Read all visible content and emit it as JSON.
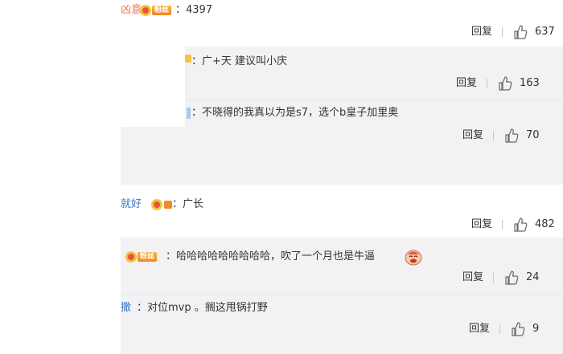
{
  "comments": [
    {
      "name_fragment": "凶意",
      "badge": "粉丝",
      "text": "：4397",
      "reply_label": "回复",
      "likes": "637"
    },
    {
      "name_fragment": "",
      "text": "：广+天 建议叫小庆",
      "reply_label": "回复",
      "likes": "163"
    },
    {
      "name_fragment": "",
      "text": "：不晓得的我真以为是s7，选个b皇子加里奥",
      "reply_label": "回复",
      "likes": "70"
    },
    {
      "name_fragment": "就好",
      "text": "：广长",
      "reply_label": "回复",
      "likes": "482"
    },
    {
      "badge": "粉丝",
      "text": "：哈哈哈哈哈哈哈哈哈，吹了一个月也是牛逼",
      "reply_label": "回复",
      "likes": "24"
    },
    {
      "name_fragment": "撒",
      "text": "：对位mvp 。搁这甩锅打野",
      "reply_label": "回复",
      "likes": "9"
    }
  ],
  "colors": {
    "accent_name": "#eb7350",
    "reply_bg": "#f2f2f5",
    "badge_orange": "#f0842a"
  }
}
